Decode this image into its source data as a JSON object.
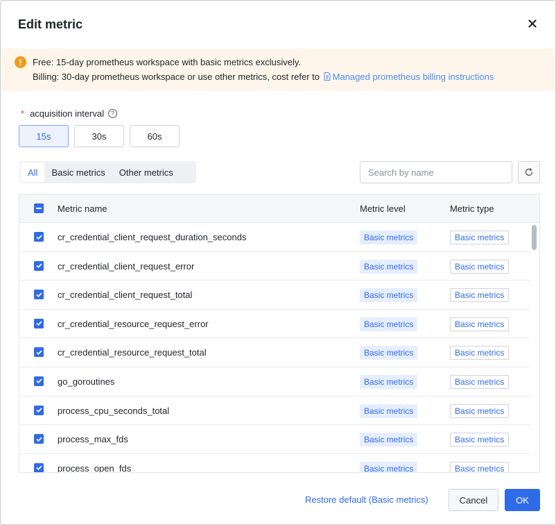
{
  "dialog": {
    "title": "Edit metric"
  },
  "alert": {
    "line1": "Free: 15-day prometheus workspace with basic metrics exclusively.",
    "line2_prefix": "Billing: 30-day prometheus workspace or use other metrics, cost refer to",
    "link_text": "Managed prometheus billing instructions",
    "icon": "warning-icon"
  },
  "interval": {
    "required_mark": "*",
    "label": "acquisition interval",
    "options": [
      "15s",
      "30s",
      "60s"
    ],
    "selected": "15s"
  },
  "tabs": {
    "items": [
      "All",
      "Basic metrics",
      "Other metrics"
    ],
    "selected": "All"
  },
  "search": {
    "placeholder": "Search by name",
    "value": ""
  },
  "table": {
    "columns": [
      "Metric name",
      "Metric level",
      "Metric type"
    ],
    "rows": [
      {
        "name": "cr_credential_client_request_duration_seconds",
        "level": "Basic metrics",
        "type": "Basic metrics",
        "checked": true
      },
      {
        "name": "cr_credential_client_request_error",
        "level": "Basic metrics",
        "type": "Basic metrics",
        "checked": true
      },
      {
        "name": "cr_credential_client_request_total",
        "level": "Basic metrics",
        "type": "Basic metrics",
        "checked": true
      },
      {
        "name": "cr_credential_resource_request_error",
        "level": "Basic metrics",
        "type": "Basic metrics",
        "checked": true
      },
      {
        "name": "cr_credential_resource_request_total",
        "level": "Basic metrics",
        "type": "Basic metrics",
        "checked": true
      },
      {
        "name": "go_goroutines",
        "level": "Basic metrics",
        "type": "Basic metrics",
        "checked": true
      },
      {
        "name": "process_cpu_seconds_total",
        "level": "Basic metrics",
        "type": "Basic metrics",
        "checked": true
      },
      {
        "name": "process_max_fds",
        "level": "Basic metrics",
        "type": "Basic metrics",
        "checked": true
      },
      {
        "name": "process_open_fds",
        "level": "Basic metrics",
        "type": "Basic metrics",
        "checked": true
      }
    ]
  },
  "footer": {
    "restore_label": "Restore default (Basic metrics)",
    "cancel_label": "Cancel",
    "ok_label": "OK"
  },
  "colors": {
    "primary": "#2f6be8",
    "warning": "#f09a1c",
    "alert_bg": "#fef6ea"
  }
}
